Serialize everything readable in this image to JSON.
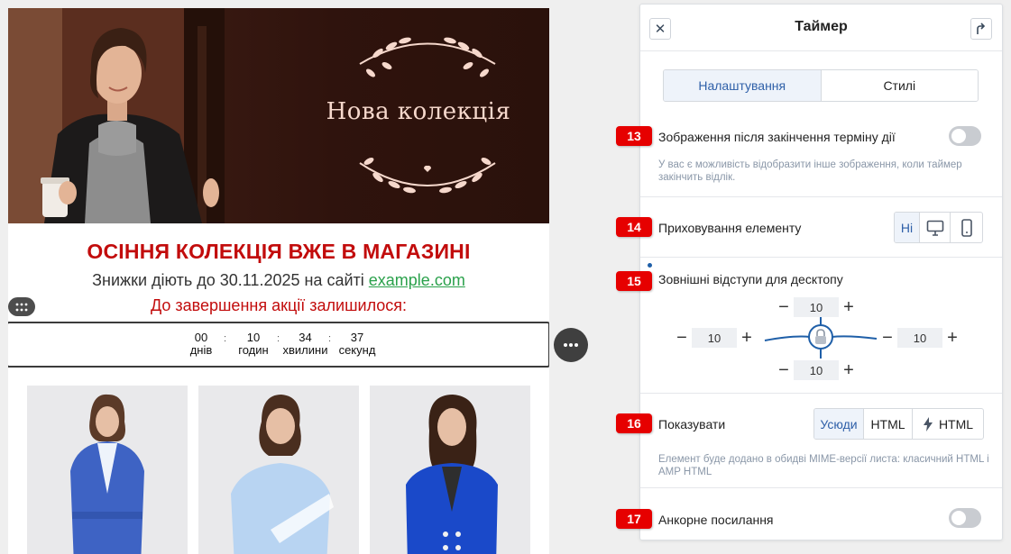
{
  "email": {
    "banner": {
      "title": "Нова колекція"
    },
    "promo": {
      "title": "ОСІННЯ КОЛЕКЦІЯ ВЖЕ В МАГАЗИНІ",
      "subtitle_prefix": "Знижки діють до 30.11.2025 на сайті",
      "subtitle_link": "example.com",
      "remaining": "До завершення акції залишилося:"
    },
    "timer": {
      "units": [
        {
          "value": "00",
          "label": "днів"
        },
        {
          "value": "10",
          "label": "годин"
        },
        {
          "value": "34",
          "label": "хвилини"
        },
        {
          "value": "37",
          "label": "секунд"
        }
      ],
      "separator": ":"
    }
  },
  "panel": {
    "title": "Таймер",
    "tabs": [
      "Налаштування",
      "Стилі"
    ],
    "sections": {
      "expired_image": {
        "badge": "13",
        "label": "Зображення після закінчення терміну дії",
        "hint": "У вас є можливість відобразити інше зображення, коли таймер закінчить відлік.",
        "enabled": false
      },
      "hide_element": {
        "badge": "14",
        "label": "Приховування елементу",
        "options": [
          "Ні",
          "desktop-icon",
          "mobile-icon"
        ],
        "selected": "Ні"
      },
      "desktop_margins": {
        "badge": "15",
        "label": "Зовнішні відступи для десктопу",
        "top": "10",
        "left": "10",
        "right": "10",
        "bottom": "10"
      },
      "show": {
        "badge": "16",
        "label": "Показувати",
        "options": [
          "Усюди",
          "HTML",
          "HTML"
        ],
        "selected": "Усюди",
        "hint": "Елемент буде додано в обидві MIME-версії листа: класичний HTML і AMP HTML"
      },
      "anchor": {
        "badge": "17",
        "label": "Анкорне посилання",
        "enabled": false
      }
    }
  },
  "colors": {
    "promo_red": "#c20c0c",
    "link_green": "#2aa14b",
    "badge_red": "#e60000",
    "active_blue": "#2e5fa8",
    "spacing_line": "#1f5fa8"
  }
}
